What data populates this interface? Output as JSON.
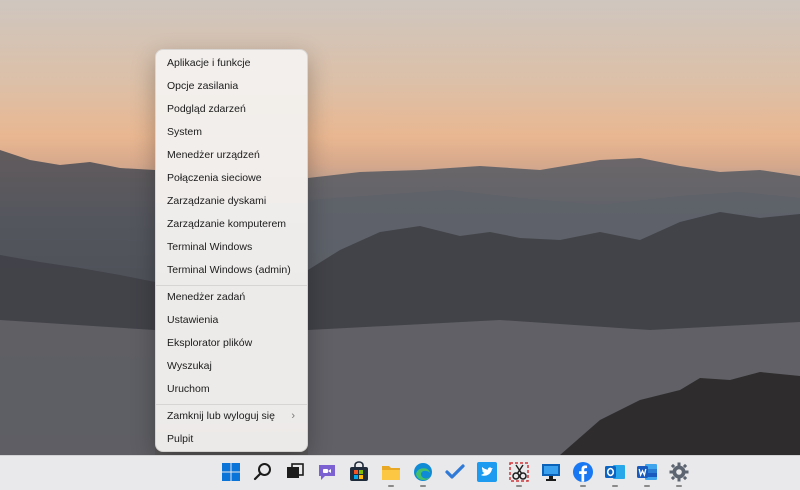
{
  "menu": {
    "items": [
      {
        "label": "Aplikacje i funkcje"
      },
      {
        "label": "Opcje zasilania"
      },
      {
        "label": "Podgląd zdarzeń"
      },
      {
        "label": "System"
      },
      {
        "label": "Menedżer urządzeń"
      },
      {
        "label": "Połączenia sieciowe"
      },
      {
        "label": "Zarządzanie dyskami"
      },
      {
        "label": "Zarządzanie komputerem"
      },
      {
        "label": "Terminal Windows"
      },
      {
        "label": "Terminal Windows (admin)"
      },
      {
        "label": "Menedżer zadań"
      },
      {
        "label": "Ustawienia"
      },
      {
        "label": "Eksplorator plików"
      },
      {
        "label": "Wyszukaj"
      },
      {
        "label": "Uruchom"
      },
      {
        "label": "Zamknij lub wyloguj się",
        "submenu_icon": "chevron-right-icon"
      },
      {
        "label": "Pulpit"
      }
    ]
  },
  "taskbar": {
    "icons": [
      "windows-start-icon",
      "search-icon",
      "task-view-icon",
      "teams-chat-icon",
      "microsoft-store-icon",
      "file-explorer-icon",
      "edge-icon",
      "todo-icon",
      "twitter-icon",
      "snipping-tool-icon",
      "remote-desktop-icon",
      "facebook-icon",
      "outlook-icon",
      "word-icon",
      "settings-gear-icon"
    ]
  },
  "colors": {
    "menu_bg": "#f3f0ee",
    "taskbar_bg": "#e9e8ea",
    "windows_blue": "#0078d4"
  }
}
